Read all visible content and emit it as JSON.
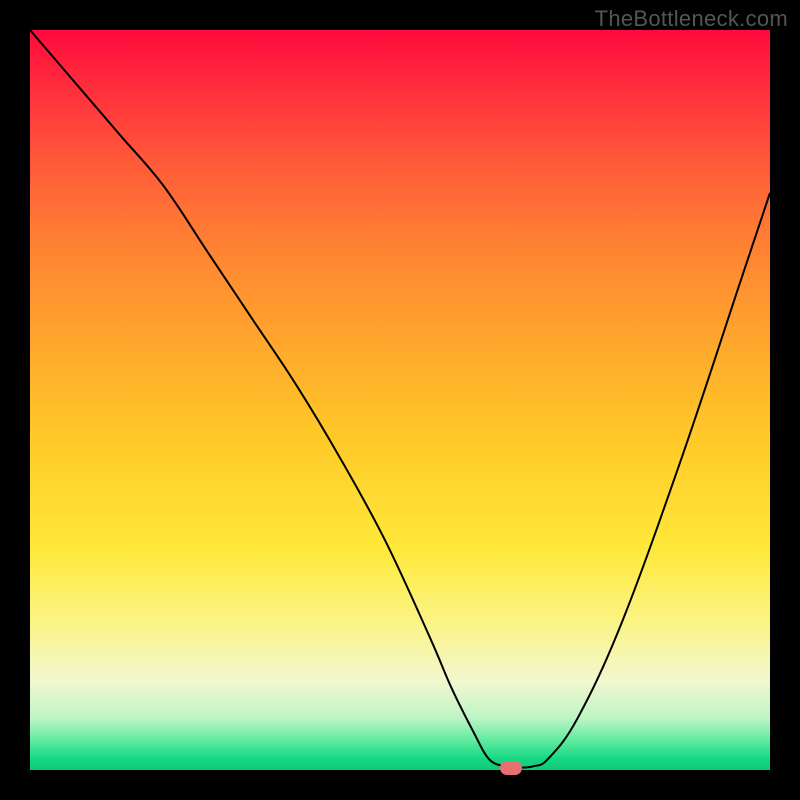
{
  "watermark": "TheBottleneck.com",
  "colors": {
    "frame": "#000000",
    "curve": "#000000",
    "marker": "#e76f6f"
  },
  "chart_data": {
    "type": "line",
    "title": "",
    "xlabel": "",
    "ylabel": "",
    "xlim": [
      0,
      100
    ],
    "ylim": [
      0,
      100
    ],
    "x": [
      0,
      6,
      12,
      18,
      24,
      30,
      36,
      42,
      48,
      54,
      57,
      60,
      62,
      64,
      65,
      66,
      68,
      70,
      74,
      80,
      88,
      96,
      100
    ],
    "values": [
      100,
      93,
      86,
      79,
      70,
      61,
      52,
      42,
      31,
      18,
      11,
      5,
      1.5,
      0.5,
      0.3,
      0.3,
      0.5,
      1.5,
      7,
      20,
      42,
      66,
      78
    ],
    "marker_x": 65,
    "marker_y": 0.3,
    "marker_size_px": {
      "w": 22,
      "h": 14
    }
  }
}
